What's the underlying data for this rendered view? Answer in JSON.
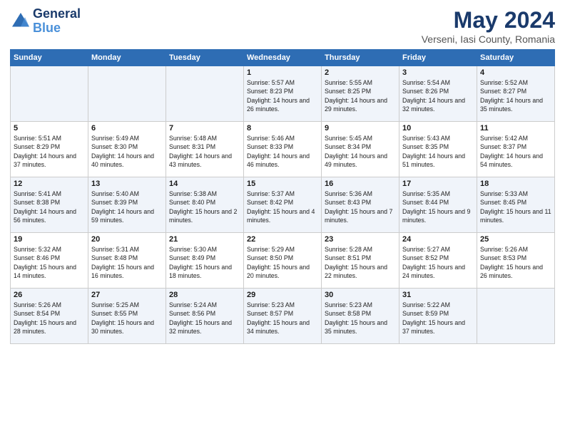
{
  "header": {
    "logo_line1": "General",
    "logo_line2": "Blue",
    "month_year": "May 2024",
    "location": "Verseni, Iasi County, Romania"
  },
  "weekdays": [
    "Sunday",
    "Monday",
    "Tuesday",
    "Wednesday",
    "Thursday",
    "Friday",
    "Saturday"
  ],
  "weeks": [
    [
      {
        "day": "",
        "sunrise": "",
        "sunset": "",
        "daylight": ""
      },
      {
        "day": "",
        "sunrise": "",
        "sunset": "",
        "daylight": ""
      },
      {
        "day": "",
        "sunrise": "",
        "sunset": "",
        "daylight": ""
      },
      {
        "day": "1",
        "sunrise": "Sunrise: 5:57 AM",
        "sunset": "Sunset: 8:23 PM",
        "daylight": "Daylight: 14 hours and 26 minutes."
      },
      {
        "day": "2",
        "sunrise": "Sunrise: 5:55 AM",
        "sunset": "Sunset: 8:25 PM",
        "daylight": "Daylight: 14 hours and 29 minutes."
      },
      {
        "day": "3",
        "sunrise": "Sunrise: 5:54 AM",
        "sunset": "Sunset: 8:26 PM",
        "daylight": "Daylight: 14 hours and 32 minutes."
      },
      {
        "day": "4",
        "sunrise": "Sunrise: 5:52 AM",
        "sunset": "Sunset: 8:27 PM",
        "daylight": "Daylight: 14 hours and 35 minutes."
      }
    ],
    [
      {
        "day": "5",
        "sunrise": "Sunrise: 5:51 AM",
        "sunset": "Sunset: 8:29 PM",
        "daylight": "Daylight: 14 hours and 37 minutes."
      },
      {
        "day": "6",
        "sunrise": "Sunrise: 5:49 AM",
        "sunset": "Sunset: 8:30 PM",
        "daylight": "Daylight: 14 hours and 40 minutes."
      },
      {
        "day": "7",
        "sunrise": "Sunrise: 5:48 AM",
        "sunset": "Sunset: 8:31 PM",
        "daylight": "Daylight: 14 hours and 43 minutes."
      },
      {
        "day": "8",
        "sunrise": "Sunrise: 5:46 AM",
        "sunset": "Sunset: 8:33 PM",
        "daylight": "Daylight: 14 hours and 46 minutes."
      },
      {
        "day": "9",
        "sunrise": "Sunrise: 5:45 AM",
        "sunset": "Sunset: 8:34 PM",
        "daylight": "Daylight: 14 hours and 49 minutes."
      },
      {
        "day": "10",
        "sunrise": "Sunrise: 5:43 AM",
        "sunset": "Sunset: 8:35 PM",
        "daylight": "Daylight: 14 hours and 51 minutes."
      },
      {
        "day": "11",
        "sunrise": "Sunrise: 5:42 AM",
        "sunset": "Sunset: 8:37 PM",
        "daylight": "Daylight: 14 hours and 54 minutes."
      }
    ],
    [
      {
        "day": "12",
        "sunrise": "Sunrise: 5:41 AM",
        "sunset": "Sunset: 8:38 PM",
        "daylight": "Daylight: 14 hours and 56 minutes."
      },
      {
        "day": "13",
        "sunrise": "Sunrise: 5:40 AM",
        "sunset": "Sunset: 8:39 PM",
        "daylight": "Daylight: 14 hours and 59 minutes."
      },
      {
        "day": "14",
        "sunrise": "Sunrise: 5:38 AM",
        "sunset": "Sunset: 8:40 PM",
        "daylight": "Daylight: 15 hours and 2 minutes."
      },
      {
        "day": "15",
        "sunrise": "Sunrise: 5:37 AM",
        "sunset": "Sunset: 8:42 PM",
        "daylight": "Daylight: 15 hours and 4 minutes."
      },
      {
        "day": "16",
        "sunrise": "Sunrise: 5:36 AM",
        "sunset": "Sunset: 8:43 PM",
        "daylight": "Daylight: 15 hours and 7 minutes."
      },
      {
        "day": "17",
        "sunrise": "Sunrise: 5:35 AM",
        "sunset": "Sunset: 8:44 PM",
        "daylight": "Daylight: 15 hours and 9 minutes."
      },
      {
        "day": "18",
        "sunrise": "Sunrise: 5:33 AM",
        "sunset": "Sunset: 8:45 PM",
        "daylight": "Daylight: 15 hours and 11 minutes."
      }
    ],
    [
      {
        "day": "19",
        "sunrise": "Sunrise: 5:32 AM",
        "sunset": "Sunset: 8:46 PM",
        "daylight": "Daylight: 15 hours and 14 minutes."
      },
      {
        "day": "20",
        "sunrise": "Sunrise: 5:31 AM",
        "sunset": "Sunset: 8:48 PM",
        "daylight": "Daylight: 15 hours and 16 minutes."
      },
      {
        "day": "21",
        "sunrise": "Sunrise: 5:30 AM",
        "sunset": "Sunset: 8:49 PM",
        "daylight": "Daylight: 15 hours and 18 minutes."
      },
      {
        "day": "22",
        "sunrise": "Sunrise: 5:29 AM",
        "sunset": "Sunset: 8:50 PM",
        "daylight": "Daylight: 15 hours and 20 minutes."
      },
      {
        "day": "23",
        "sunrise": "Sunrise: 5:28 AM",
        "sunset": "Sunset: 8:51 PM",
        "daylight": "Daylight: 15 hours and 22 minutes."
      },
      {
        "day": "24",
        "sunrise": "Sunrise: 5:27 AM",
        "sunset": "Sunset: 8:52 PM",
        "daylight": "Daylight: 15 hours and 24 minutes."
      },
      {
        "day": "25",
        "sunrise": "Sunrise: 5:26 AM",
        "sunset": "Sunset: 8:53 PM",
        "daylight": "Daylight: 15 hours and 26 minutes."
      }
    ],
    [
      {
        "day": "26",
        "sunrise": "Sunrise: 5:26 AM",
        "sunset": "Sunset: 8:54 PM",
        "daylight": "Daylight: 15 hours and 28 minutes."
      },
      {
        "day": "27",
        "sunrise": "Sunrise: 5:25 AM",
        "sunset": "Sunset: 8:55 PM",
        "daylight": "Daylight: 15 hours and 30 minutes."
      },
      {
        "day": "28",
        "sunrise": "Sunrise: 5:24 AM",
        "sunset": "Sunset: 8:56 PM",
        "daylight": "Daylight: 15 hours and 32 minutes."
      },
      {
        "day": "29",
        "sunrise": "Sunrise: 5:23 AM",
        "sunset": "Sunset: 8:57 PM",
        "daylight": "Daylight: 15 hours and 34 minutes."
      },
      {
        "day": "30",
        "sunrise": "Sunrise: 5:23 AM",
        "sunset": "Sunset: 8:58 PM",
        "daylight": "Daylight: 15 hours and 35 minutes."
      },
      {
        "day": "31",
        "sunrise": "Sunrise: 5:22 AM",
        "sunset": "Sunset: 8:59 PM",
        "daylight": "Daylight: 15 hours and 37 minutes."
      },
      {
        "day": "",
        "sunrise": "",
        "sunset": "",
        "daylight": ""
      }
    ]
  ]
}
